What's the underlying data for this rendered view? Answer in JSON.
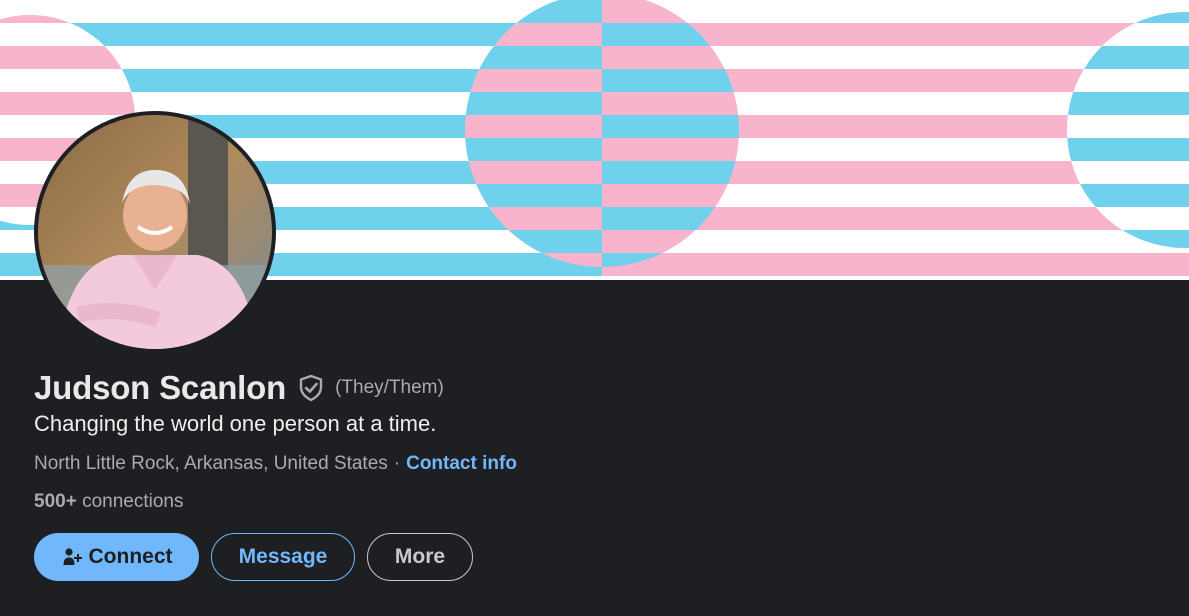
{
  "profile": {
    "name": "Judson Scanlon",
    "pronouns": "(They/Them)",
    "headline": "Changing the world one person at a time.",
    "location": "North Little Rock, Arkansas, United States",
    "separator": "·",
    "contact_info_label": "Contact info",
    "connections_count": "500+",
    "connections_label": "connections"
  },
  "actions": {
    "connect_label": "Connect",
    "message_label": "Message",
    "more_label": "More"
  },
  "icons": {
    "verify": "verified-shield-icon",
    "connect": "add-person-icon"
  },
  "colors": {
    "background": "#1d1f23",
    "accent": "#71b7fb",
    "banner_blue": "#6fd1ec",
    "banner_pink": "#f8b4cc",
    "banner_white": "#ffffff"
  }
}
